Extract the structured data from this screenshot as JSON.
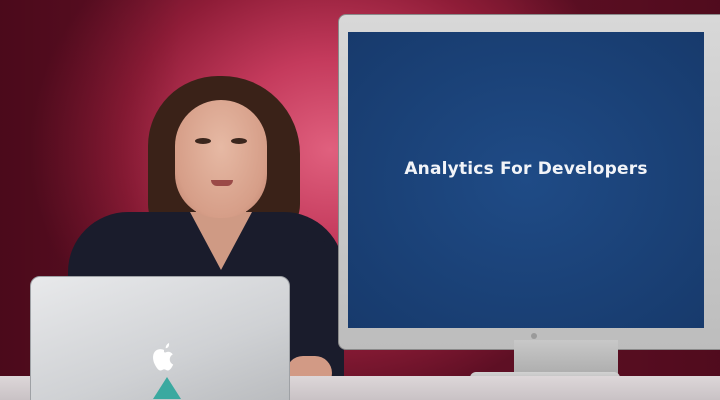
{
  "scene": {
    "background_color": "#b3304f",
    "monitor": {
      "screen_text": "Analytics For Developers",
      "screen_color": "#1b4277"
    },
    "laptop": {
      "logo": "apple-logo-icon"
    }
  }
}
